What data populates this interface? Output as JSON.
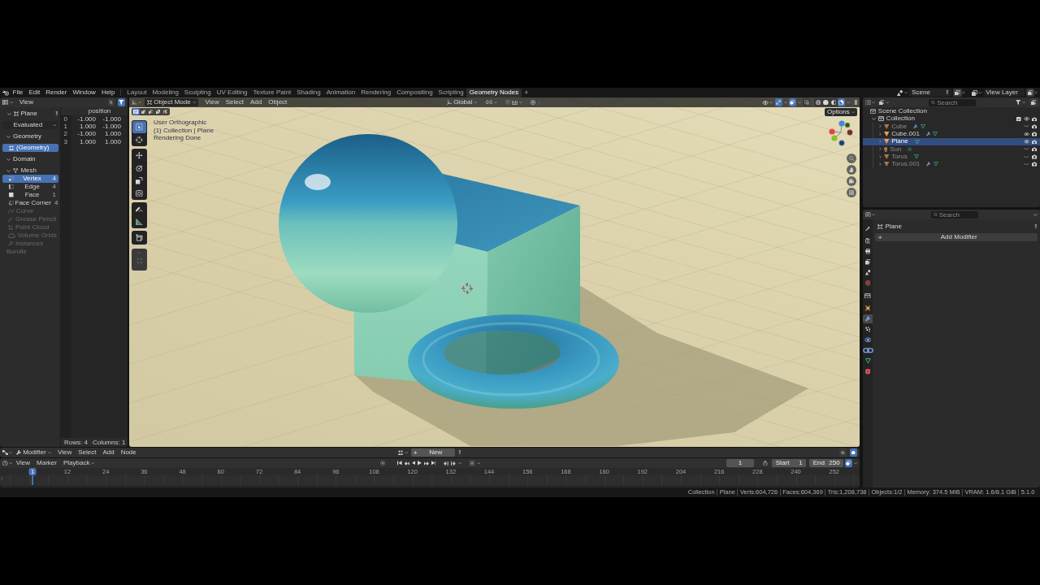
{
  "top_bar": {
    "menus": [
      "File",
      "Edit",
      "Render",
      "Window",
      "Help"
    ],
    "workspaces": [
      {
        "label": "Layout",
        "selected": false
      },
      {
        "label": "Modeling",
        "selected": false
      },
      {
        "label": "Sculpting",
        "selected": false
      },
      {
        "label": "UV Editing",
        "selected": false
      },
      {
        "label": "Texture Paint",
        "selected": false
      },
      {
        "label": "Shading",
        "selected": false
      },
      {
        "label": "Animation",
        "selected": false
      },
      {
        "label": "Rendering",
        "selected": false
      },
      {
        "label": "Compositing",
        "selected": false
      },
      {
        "label": "Scripting",
        "selected": false
      },
      {
        "label": "Geometry Nodes",
        "selected": true
      }
    ],
    "add_workspace": "+",
    "scene": "Scene",
    "view_layer": "View Layer"
  },
  "spreadsheet": {
    "menu": "View",
    "toggles": [
      {
        "kind": "selected_only",
        "on": false
      },
      {
        "kind": "filter",
        "on": true
      }
    ],
    "object": {
      "label": "Plane",
      "expanded": true
    },
    "evaluation": "Evaluated",
    "geometry": {
      "label": "Geometry",
      "expanded": true,
      "items": [
        {
          "label": "(Geometry)",
          "selected": true
        }
      ]
    },
    "domain": {
      "label": "Domain",
      "expanded": true,
      "items": [
        {
          "label": "Mesh",
          "kind": "mesh",
          "disabled": false,
          "expanded": true,
          "children": [
            {
              "label": "Vertex",
              "kind": "vertex",
              "count": "4",
              "selected": true
            },
            {
              "label": "Edge",
              "kind": "edge",
              "count": "4",
              "selected": false
            },
            {
              "label": "Face",
              "kind": "face",
              "count": "1",
              "selected": false
            },
            {
              "label": "Face Corner",
              "kind": "corner",
              "count": "4",
              "selected": false
            }
          ]
        },
        {
          "label": "Curve",
          "kind": "curve",
          "disabled": true
        },
        {
          "label": "Grease Pencil",
          "kind": "grease_pencil",
          "disabled": true
        },
        {
          "label": "Point Cloud",
          "kind": "point_cloud",
          "disabled": true
        },
        {
          "label": "Volume Grids",
          "kind": "volume",
          "disabled": true
        },
        {
          "label": "Instances",
          "kind": "instances",
          "disabled": true
        }
      ]
    },
    "bundle": {
      "label": "Bundle",
      "disabled": true
    },
    "table": {
      "column": "position",
      "rows": [
        {
          "index": "0",
          "values": [
            "-1.000",
            "-1.000"
          ]
        },
        {
          "index": "1",
          "values": [
            "1.000",
            "-1.000"
          ]
        },
        {
          "index": "2",
          "values": [
            "-1.000",
            "1.000"
          ]
        },
        {
          "index": "3",
          "values": [
            "1.000",
            "1.000"
          ]
        }
      ],
      "row_count": "Rows: 4",
      "column_count": "Columns: 1"
    }
  },
  "viewport": {
    "mode": "Object Mode",
    "menus": [
      "View",
      "Select",
      "Add",
      "Object"
    ],
    "orientation": "Global",
    "proportional": {
      "on": false
    },
    "header_toggles": [
      {
        "kind": "gizmos",
        "on": true
      },
      {
        "kind": "overlays",
        "on": true
      },
      {
        "kind": "xray",
        "on": false
      }
    ],
    "shading": [
      {
        "kind": "wireframe",
        "selected": false
      },
      {
        "kind": "solid",
        "selected": false
      },
      {
        "kind": "material",
        "selected": false
      },
      {
        "kind": "rendered",
        "selected": true
      }
    ],
    "select_modes": [
      {
        "kind": "set",
        "selected": true
      },
      {
        "kind": "extend",
        "selected": false
      },
      {
        "kind": "subtract",
        "selected": false
      },
      {
        "kind": "invert",
        "selected": false
      },
      {
        "kind": "intersect",
        "selected": false
      }
    ],
    "tool_groups": [
      {
        "tools": [
          {
            "kind": "select_box",
            "selected": true
          },
          {
            "kind": "cursor",
            "selected": false
          }
        ]
      },
      {
        "tools": [
          {
            "kind": "move",
            "selected": false
          },
          {
            "kind": "rotate",
            "selected": false
          },
          {
            "kind": "scale",
            "selected": false
          },
          {
            "kind": "transform",
            "selected": false
          }
        ]
      },
      {
        "tools": [
          {
            "kind": "annotate",
            "selected": false
          },
          {
            "kind": "measure",
            "selected": false
          }
        ]
      },
      {
        "tools": [
          {
            "kind": "add_cube",
            "selected": false
          }
        ]
      }
    ],
    "info": [
      "User Orthographic",
      "(1) Collection | Plane",
      "Rendering Done"
    ],
    "options": "Options"
  },
  "outliner": {
    "search_placeholder": "Search",
    "root": "Scene Collection",
    "collection": {
      "label": "Collection",
      "expanded": true,
      "checked": true,
      "visible": true,
      "children": [
        {
          "label": "Cube",
          "kind": "mesh",
          "modifier": true,
          "visible": false,
          "selected": false
        },
        {
          "label": "Cube.001",
          "kind": "mesh",
          "modifier": true,
          "visible": true,
          "selected": false
        },
        {
          "label": "Plane",
          "kind": "mesh",
          "modifier": false,
          "visible": true,
          "selected": true
        },
        {
          "label": "Sun",
          "kind": "light",
          "modifier": false,
          "visible": false,
          "selected": false
        },
        {
          "label": "Torus",
          "kind": "mesh",
          "modifier": false,
          "visible": false,
          "selected": false
        },
        {
          "label": "Torus.001",
          "kind": "mesh",
          "modifier": true,
          "visible": false,
          "selected": false
        }
      ]
    }
  },
  "properties": {
    "search_placeholder": "Search",
    "tab_groups": [
      {
        "tabs": [
          {
            "kind": "tool",
            "selected": false
          }
        ]
      },
      {
        "tabs": [
          {
            "kind": "render",
            "selected": false
          },
          {
            "kind": "output",
            "selected": false
          },
          {
            "kind": "view_layer",
            "selected": false
          },
          {
            "kind": "scene",
            "selected": false
          },
          {
            "kind": "world",
            "selected": false
          }
        ]
      },
      {
        "tabs": [
          {
            "kind": "collection",
            "selected": false
          }
        ]
      },
      {
        "tabs": [
          {
            "kind": "object",
            "selected": false
          },
          {
            "kind": "modifiers",
            "selected": true
          },
          {
            "kind": "particles",
            "selected": false
          },
          {
            "kind": "physics",
            "selected": false
          },
          {
            "kind": "constraints",
            "selected": false
          },
          {
            "kind": "data",
            "selected": false
          },
          {
            "kind": "material",
            "selected": false
          }
        ]
      }
    ],
    "object": "Plane",
    "add_modifier": "Add Modifier"
  },
  "node_editor": {
    "context": "Modifier",
    "menus": [
      "View",
      "Select",
      "Add",
      "Node"
    ],
    "new_button": "New",
    "toggles": [
      {
        "on": false
      },
      {
        "on": true
      }
    ]
  },
  "timeline": {
    "menus": [
      "View",
      "Marker"
    ],
    "playback": "Playback",
    "auto_keying": {
      "on": false
    },
    "current_frame": "1",
    "start_label": "Start",
    "start": "1",
    "end_label": "End",
    "end": "250",
    "view_toggle": {
      "on": true
    },
    "ticks": [
      "12",
      "24",
      "36",
      "48",
      "60",
      "72",
      "84",
      "96",
      "108",
      "120",
      "132",
      "144",
      "156",
      "168",
      "180",
      "192",
      "204",
      "216",
      "228",
      "240",
      "252"
    ],
    "playhead": {
      "label": "1",
      "level": 0.038
    }
  },
  "status_bar": [
    "Collection",
    "Plane",
    "Verts:604,726",
    "Faces:604,369",
    "Tris:1,208,738",
    "Objects:1/2",
    "Memory: 374.5 MiB",
    "VRAM: 1.6/8.1 GiB",
    "5.1.0"
  ]
}
